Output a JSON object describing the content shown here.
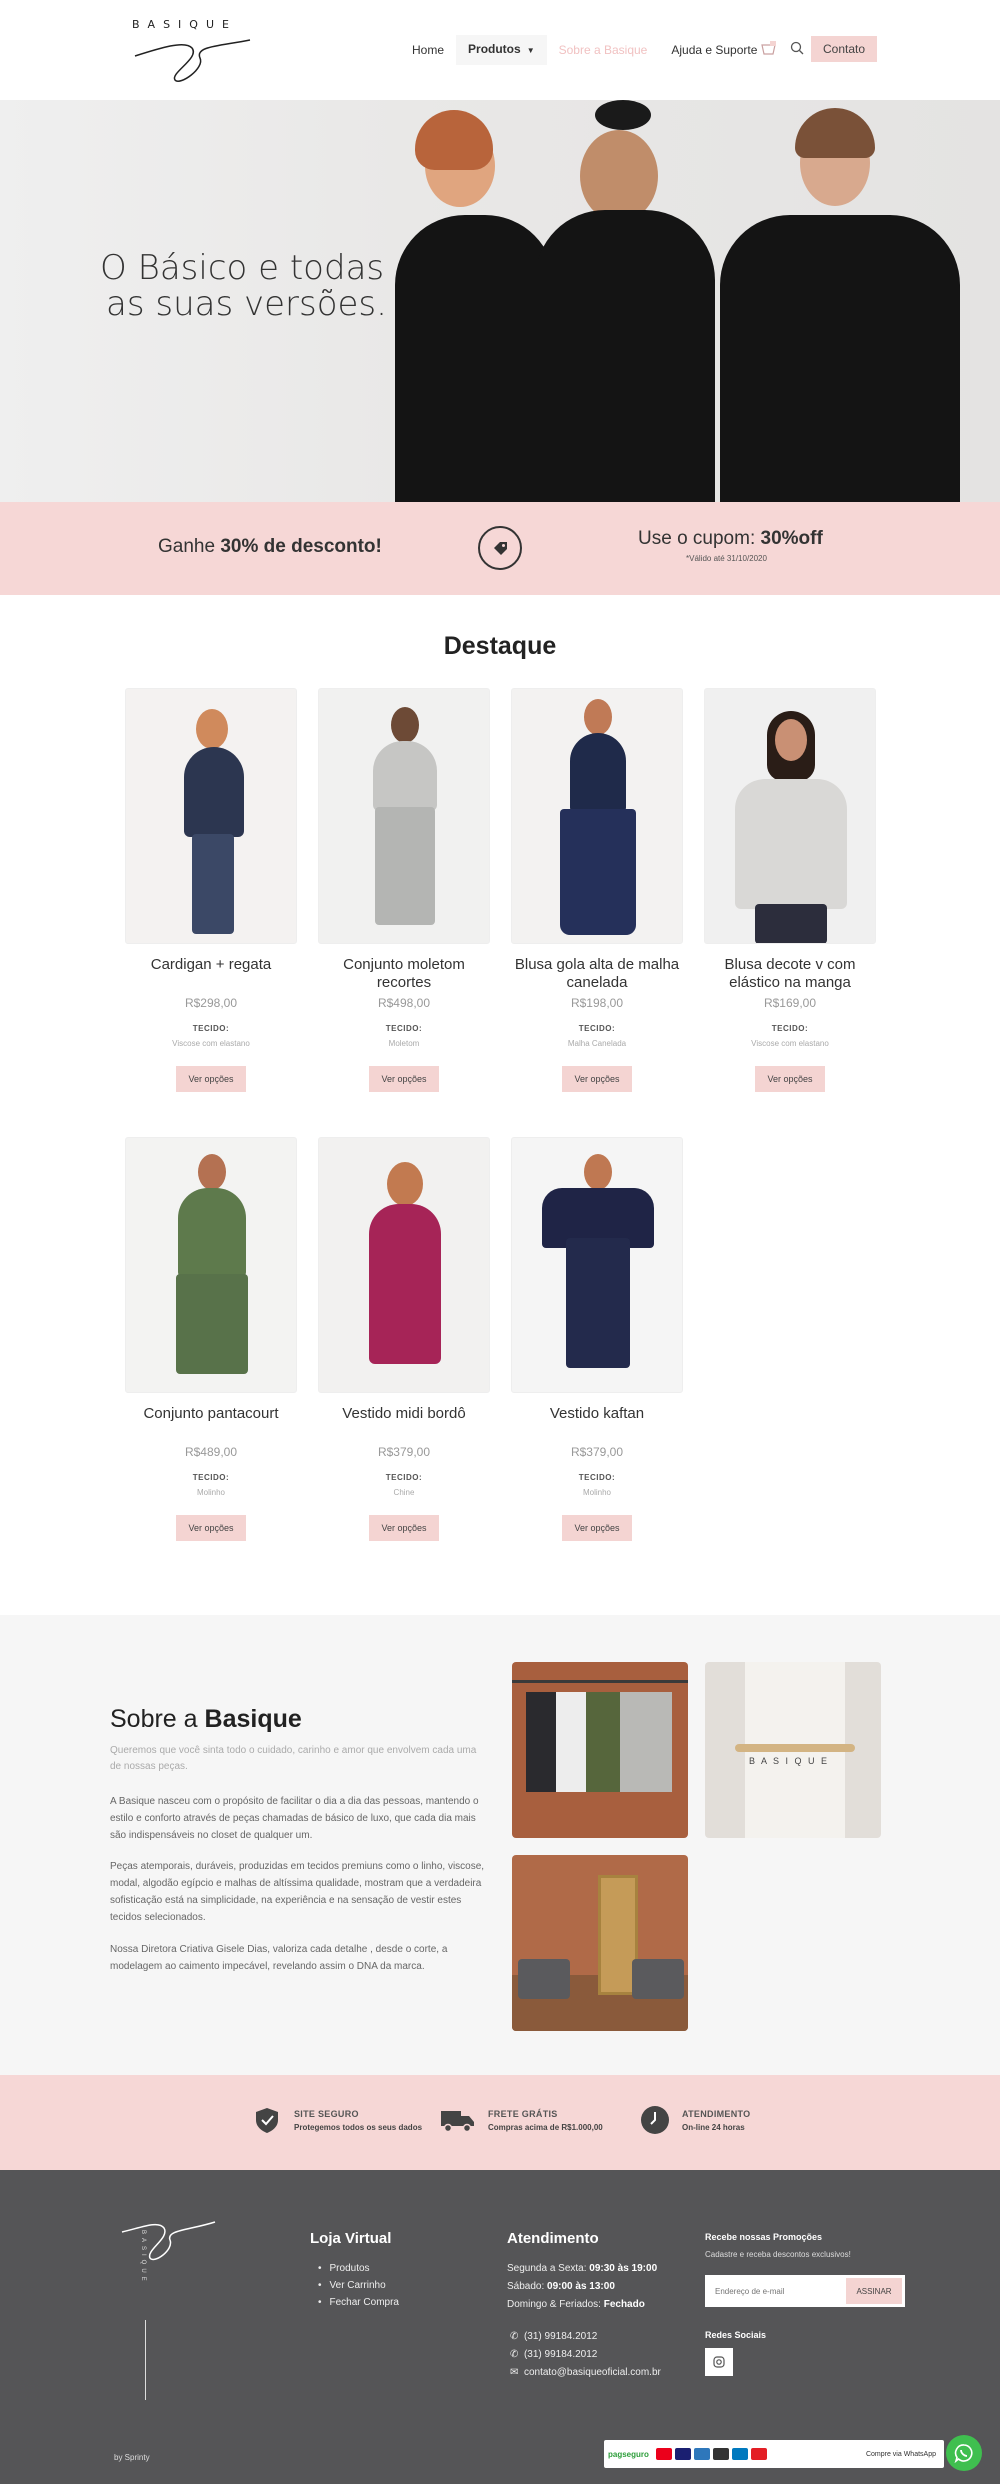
{
  "brand": {
    "name": "BASIQUE"
  },
  "nav": {
    "items": [
      "Home",
      "Produtos",
      "Sobre a Basique",
      "Ajuda e Suporte"
    ],
    "contact": "Contato"
  },
  "hero": {
    "title_line1": "O Básico e todas",
    "title_line2": "as suas versões."
  },
  "promo": {
    "left_prefix": "Ganhe ",
    "left_bold": "30% de desconto!",
    "right_prefix": "Use o cupom: ",
    "right_bold": "30%off",
    "note": "*Válido até 31/10/2020"
  },
  "destaque": {
    "title": "Destaque",
    "tecido_label": "TECIDO:",
    "button_label": "Ver opções",
    "products": [
      {
        "name": "Cardigan + regata",
        "price": "R$298,00",
        "fabric": "Viscose com elastano"
      },
      {
        "name": "Conjunto moletom recortes",
        "price": "R$498,00",
        "fabric": "Moletom"
      },
      {
        "name": "Blusa gola alta de malha canelada",
        "price": "R$198,00",
        "fabric": "Malha Canelada"
      },
      {
        "name": "Blusa decote v com elástico na manga",
        "price": "R$169,00",
        "fabric": "Viscose com elastano"
      },
      {
        "name": "Conjunto pantacourt",
        "price": "R$489,00",
        "fabric": "Molinho"
      },
      {
        "name": "Vestido midi bordô",
        "price": "R$379,00",
        "fabric": "Chine"
      },
      {
        "name": "Vestido kaftan",
        "price": "R$379,00",
        "fabric": "Molinho"
      }
    ]
  },
  "about": {
    "title_prefix": "Sobre a ",
    "title_bold": "Basique",
    "subtitle": "Queremos que você sinta todo o cuidado, carinho e amor que envolvem cada uma de nossas peças.",
    "p1": "A Basique nasceu com o propósito de facilitar o dia a dia das pessoas, mantendo o estilo e conforto através de peças chamadas de básico de luxo, que cada dia mais são indispensáveis no closet de qualquer um.",
    "p2": "Peças atemporais, duráveis, produzidas em tecidos premiuns como o linho, viscose, modal, algodão egípcio e malhas de altíssima qualidade, mostram que a verdadeira sofisticação está na simplicidade, na experiência e na sensação de vestir estes tecidos selecionados.",
    "p3": "Nossa Diretora Criativa Gisele Dias, valoriza cada detalhe , desde o corte, a modelagem ao caimento impecável, revelando assim o DNA da marca.",
    "hanger_text": "B A S I Q U E"
  },
  "features": [
    {
      "title": "SITE SEGURO",
      "text": "Protegemos todos os seus dados"
    },
    {
      "title": "FRETE GRÁTIS",
      "text": "Compras acima de R$1.000,00"
    },
    {
      "title": "ATENDIMENTO",
      "text": "On-line 24 horas"
    }
  ],
  "footer": {
    "loja_title": "Loja Virtual",
    "loja_items": [
      "Produtos",
      "Ver Carrinho",
      "Fechar Compra"
    ],
    "atend_title": "Atendimento",
    "weekdays": "Segunda a Sexta: ",
    "weekdays_hours": "09:30 às 19:00",
    "saturday": "Sábado: ",
    "saturday_hours": "09:00 às 13:00",
    "sunday": "Domingo & Feriados: ",
    "sunday_hours": "Fechado",
    "phone1": "(31) 99184.2012",
    "phone2": "(31) 99184.2012",
    "email": "contato@basiqueoficial.com.br",
    "promo_title": "Recebe nossas Promoções",
    "promo_text": "Cadastre e receba descontos exclusivos!",
    "email_placeholder": "Endereço de e-mail",
    "subscribe": "ASSINAR",
    "social_title": "Redes Sociais",
    "credit": "by Sprinty",
    "pagseguro": "pagseguro",
    "whatsapp_label": "Compre via WhatsApp"
  }
}
